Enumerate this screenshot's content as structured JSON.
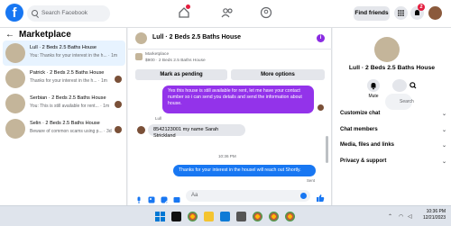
{
  "topbar": {
    "search_placeholder": "Search Facebook",
    "find_friends": "Find friends",
    "notifications_badge": "2"
  },
  "left": {
    "title": "Marketplace",
    "conversations": [
      {
        "title": "Lull · 2 Beds 2.5 Baths House",
        "preview": "You: Thanks for your interest in the h...",
        "time": "1m"
      },
      {
        "title": "Patrick · 2 Beds 2.5 Baths House",
        "preview": "Thanks for your interest in the h...",
        "time": "1m"
      },
      {
        "title": "Serbian · 2 Beds 2.5 Baths House",
        "preview": "You: This is still available for rent...",
        "time": "1m"
      },
      {
        "title": "Selin · 2 Beds 2.5 Baths House",
        "preview": "Beware of common scams using p...",
        "time": "3d"
      }
    ]
  },
  "chat": {
    "title": "Lull · 2 Beds 2.5 Baths House",
    "listing_label": "Marketplace",
    "listing_price": "$900 · 2 Beds 2.5 Baths House",
    "mark_pending": "Mark as pending",
    "more_options": "More options",
    "msg1": "Yes this house is still available for rent, let me have your contact number so i can send you details and send the information about house.",
    "sender_name": "Lull",
    "msg2": "8542123001 my name Sarah Strickland",
    "timestamp": "10:36 PM",
    "msg3": "Thanks for your interest in the housel will reach out Shortly.",
    "sent_label": "Sent",
    "input_placeholder": "Aa"
  },
  "right": {
    "title": "Lull · 2 Beds 2.5 Baths House",
    "mute_label": "Mute",
    "search_label": "Search",
    "items": [
      "Customize chat",
      "Chat members",
      "Media, files and links",
      "Privacy & support"
    ]
  },
  "taskbar": {
    "time": "10:36 PM",
    "date": "12/21/2023"
  },
  "colors": {
    "brand": "#1877f2",
    "outgoing_purple": "#9333ea",
    "outgoing_blue": "#1877f2"
  }
}
